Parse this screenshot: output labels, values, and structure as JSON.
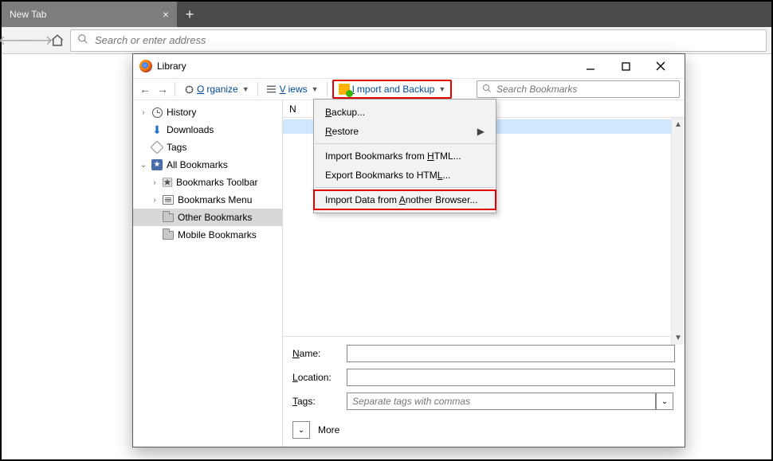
{
  "browser": {
    "tab_title": "New Tab",
    "address_placeholder": "Search or enter address"
  },
  "library": {
    "title": "Library",
    "toolbar": {
      "organize": "rganize",
      "organize_prefix": "O",
      "views": "iews",
      "views_prefix": "V",
      "import_backup_prefix": "I",
      "import_backup": "mport and Backup",
      "search_placeholder": "Search Bookmarks"
    },
    "tree": {
      "history": "History",
      "downloads": "Downloads",
      "tags": "Tags",
      "all_bookmarks": "All Bookmarks",
      "toolbar": "Bookmarks Toolbar",
      "menu": "Bookmarks Menu",
      "other": "Other Bookmarks",
      "mobile": "Mobile Bookmarks"
    },
    "list": {
      "col_name": "N"
    },
    "details": {
      "name_u": "N",
      "name": "ame:",
      "location_u": "L",
      "location": "ocation:",
      "tags_u": "T",
      "tags": "ags:",
      "tags_placeholder": "Separate tags with commas",
      "more": "More"
    },
    "menu": {
      "backup_u": "B",
      "backup": "ackup...",
      "restore_u": "R",
      "restore": "estore",
      "import_html": "Import Bookmarks from ",
      "import_html_u": "H",
      "import_html_s": "TML...",
      "export_html": "Export Bookmarks to HTM",
      "export_html_u": "L",
      "export_html_s": "...",
      "import_other": "Import Data from ",
      "import_other_u": "A",
      "import_other_s": "nother Browser..."
    }
  }
}
